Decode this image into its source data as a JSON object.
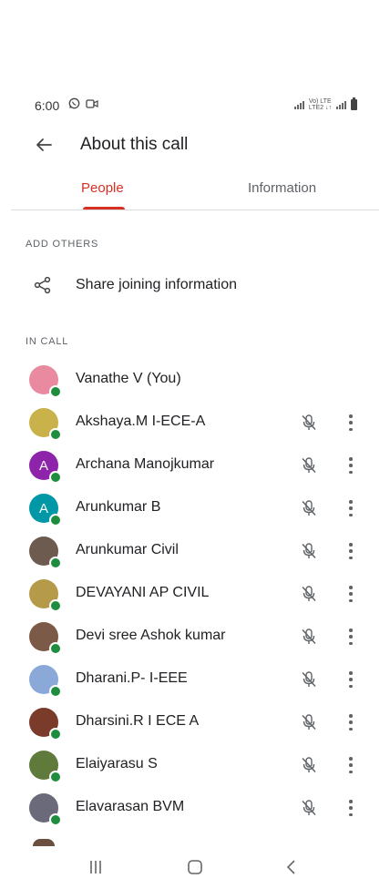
{
  "status_bar": {
    "time": "6:00",
    "network_top": "Vo) LTE",
    "network_bottom": "LTE2 ↓↑"
  },
  "header": {
    "title": "About this call"
  },
  "tabs": [
    {
      "label": "People",
      "active": true
    },
    {
      "label": "Information",
      "active": false
    }
  ],
  "add_others": {
    "heading": "ADD OTHERS",
    "share_label": "Share joining information"
  },
  "in_call": {
    "heading": "IN CALL"
  },
  "participants": [
    {
      "name": "Vanathe V (You)",
      "initial": "",
      "avatar_color": "#e98aa0",
      "muted": false
    },
    {
      "name": "Akshaya.M I-ECE-A",
      "initial": "",
      "avatar_color": "#c9b24a",
      "muted": true
    },
    {
      "name": "Archana Manojkumar",
      "initial": "A",
      "avatar_color": "#8e24aa",
      "muted": true
    },
    {
      "name": "Arunkumar B",
      "initial": "A",
      "avatar_color": "#0097a7",
      "muted": true
    },
    {
      "name": "Arunkumar Civil",
      "initial": "",
      "avatar_color": "#6d5b50",
      "muted": true
    },
    {
      "name": "DEVAYANI AP CIVIL",
      "initial": "",
      "avatar_color": "#b59a4a",
      "muted": true
    },
    {
      "name": "Devi sree Ashok kumar",
      "initial": "",
      "avatar_color": "#7b5a48",
      "muted": true
    },
    {
      "name": "Dharani.P- I-EEE",
      "initial": "",
      "avatar_color": "#8aa8d8",
      "muted": true
    },
    {
      "name": "Dharsini.R I ECE A",
      "initial": "",
      "avatar_color": "#7a3b2a",
      "muted": true
    },
    {
      "name": "Elaiyarasu S",
      "initial": "",
      "avatar_color": "#5f7a3a",
      "muted": true
    },
    {
      "name": "Elavarasan BVM",
      "initial": "",
      "avatar_color": "#6a6a7a",
      "muted": true
    }
  ],
  "colors": {
    "accent": "#d93025",
    "online": "#1e8e3e",
    "muted_text": "#5f6368"
  }
}
